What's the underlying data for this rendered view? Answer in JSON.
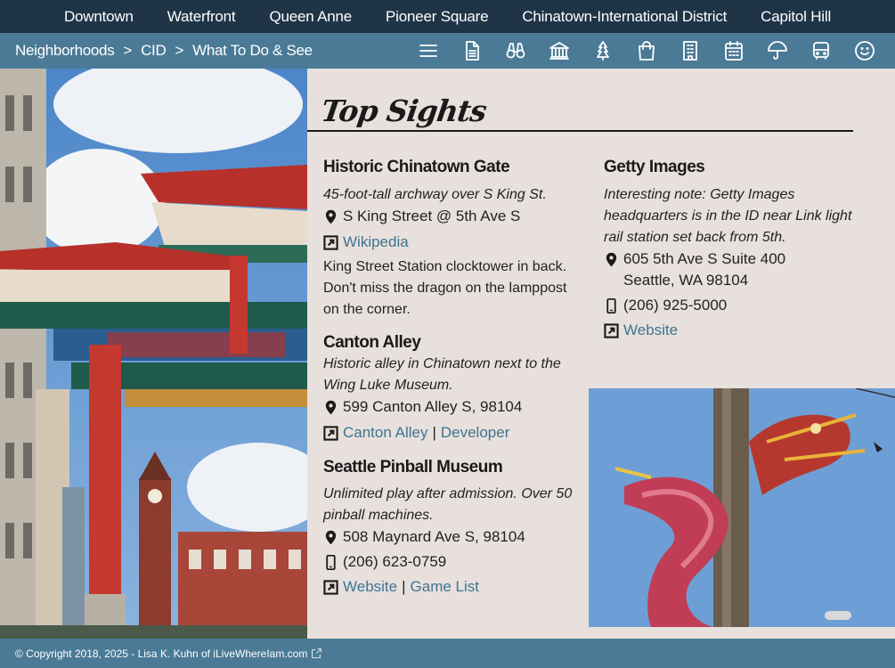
{
  "topnav": [
    {
      "label": "Downtown"
    },
    {
      "label": "Waterfront"
    },
    {
      "label": "Queen Anne"
    },
    {
      "label": "Pioneer Square"
    },
    {
      "label": "Chinatown-International District"
    },
    {
      "label": "Capitol Hill"
    }
  ],
  "breadcrumb": {
    "items": [
      "Neighborhoods",
      "CID",
      "What To Do & See"
    ],
    "separator": ">"
  },
  "toolbar_icons": [
    "menu-icon",
    "document-icon",
    "binoculars-icon",
    "museum-icon",
    "tree-icon",
    "shopping-bag-icon",
    "hotel-icon",
    "calendar-icon",
    "umbrella-icon",
    "bus-icon",
    "smiley-icon"
  ],
  "section": {
    "title": "Top Sights"
  },
  "sights": {
    "gate": {
      "name": "Historic Chinatown Gate",
      "desc": "45-foot-tall archway over S King St.",
      "address": "S King Street @ 5th Ave S",
      "link1": "Wikipedia",
      "note": "King Street Station clocktower in back. Don't miss the dragon on the lamppost on the corner."
    },
    "canton": {
      "name": "Canton Alley",
      "desc": "Historic alley in Chinatown next to the Wing Luke Museum.",
      "address": "599 Canton Alley S, 98104",
      "link1": "Canton Alley",
      "link2": "Developer"
    },
    "pinball": {
      "name": "Seattle Pinball Museum",
      "desc": "Unlimited play after admission. Over 50 pinball machines.",
      "address": "508 Maynard Ave S, 98104",
      "phone": "(206) 623-0759",
      "link1": "Website",
      "link2": "Game List"
    },
    "getty": {
      "name": "Getty Images",
      "desc": "Interesting note: Getty Images headquarters is in the ID near Link light rail station set back from 5th.",
      "address_line1": "605 5th Ave S Suite 400",
      "address_line2": "Seattle, WA 98104",
      "phone": "(206) 925-5000",
      "link1": "Website"
    }
  },
  "footer": {
    "copyright": "© Copyright 2018, 2025 - Lisa K. Kuhn of iLiveWhereIam.com"
  },
  "colors": {
    "topbar": "#1f3447",
    "subbar": "#4a7a96",
    "panel": "#e8e0dc",
    "link": "#3f7493"
  }
}
